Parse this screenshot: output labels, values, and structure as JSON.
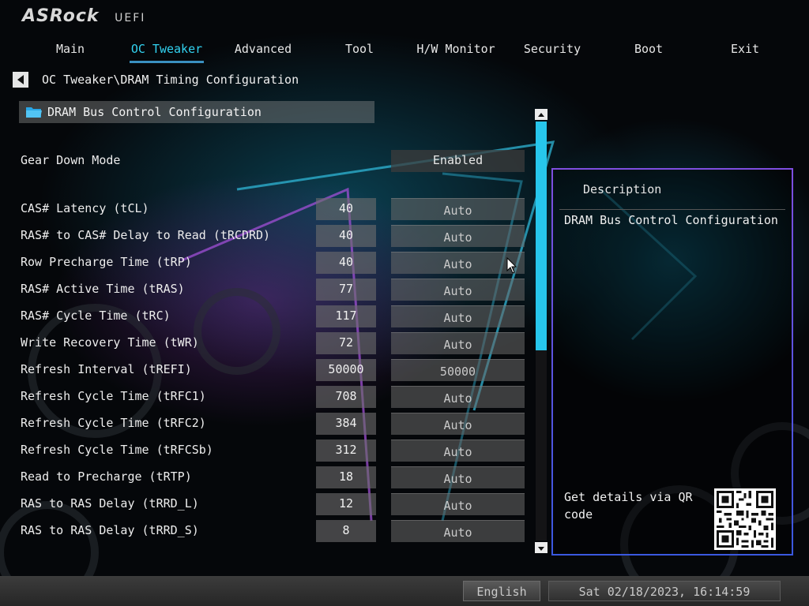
{
  "header": {
    "brand": "ASRock",
    "firmware": "UEFI"
  },
  "tabs": [
    {
      "label": "Main",
      "active": false
    },
    {
      "label": "OC Tweaker",
      "active": true
    },
    {
      "label": "Advanced",
      "active": false
    },
    {
      "label": "Tool",
      "active": false
    },
    {
      "label": "H/W Monitor",
      "active": false
    },
    {
      "label": "Security",
      "active": false
    },
    {
      "label": "Boot",
      "active": false
    },
    {
      "label": "Exit",
      "active": false
    }
  ],
  "breadcrumb": "OC Tweaker\\DRAM Timing Configuration",
  "section": {
    "label": "DRAM Bus Control Configuration",
    "icon": "folder-icon"
  },
  "gear_down": {
    "label": "Gear Down Mode",
    "value": "Enabled"
  },
  "timings": [
    {
      "label": "CAS# Latency (tCL)",
      "current": "40",
      "setting": "Auto"
    },
    {
      "label": "RAS# to CAS# Delay to Read  (tRCDRD)",
      "current": "40",
      "setting": "Auto"
    },
    {
      "label": "Row Precharge Time (tRP)",
      "current": "40",
      "setting": "Auto"
    },
    {
      "label": "RAS# Active Time (tRAS)",
      "current": "77",
      "setting": "Auto"
    },
    {
      "label": "RAS# Cycle Time (tRC)",
      "current": "117",
      "setting": "Auto"
    },
    {
      "label": "Write Recovery Time (tWR)",
      "current": "72",
      "setting": "Auto"
    },
    {
      "label": "Refresh Interval (tREFI)",
      "current": "50000",
      "setting": "50000"
    },
    {
      "label": "Refresh Cycle Time (tRFC1)",
      "current": "708",
      "setting": "Auto"
    },
    {
      "label": "Refresh Cycle Time (tRFC2)",
      "current": "384",
      "setting": "Auto"
    },
    {
      "label": "Refresh Cycle Time (tRFCSb)",
      "current": "312",
      "setting": "Auto"
    },
    {
      "label": "Read to Precharge (tRTP)",
      "current": "18",
      "setting": "Auto"
    },
    {
      "label": "RAS to RAS Delay (tRRD_L)",
      "current": "12",
      "setting": "Auto"
    },
    {
      "label": "RAS to RAS Delay (tRRD_S)",
      "current": "8",
      "setting": "Auto"
    }
  ],
  "description": {
    "title": "Description",
    "text": "DRAM Bus Control Configuration",
    "qr_text": "Get details via QR code"
  },
  "footer": {
    "language": "English",
    "datetime": "Sat 02/18/2023, 16:14:59"
  },
  "colors": {
    "accent": "#32d2f0",
    "scrollbar": "#27c6ec",
    "panel_border": "#7f4ee0"
  }
}
